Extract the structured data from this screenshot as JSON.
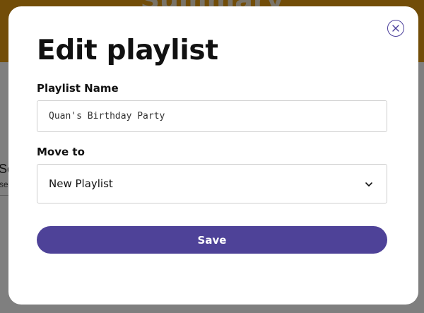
{
  "background": {
    "header_title": "Summary",
    "partial_title": "So",
    "partial_subtitle": "se"
  },
  "modal": {
    "title": "Edit playlist",
    "close_icon": "close-icon",
    "playlist_name": {
      "label": "Playlist Name",
      "value": "Quan's Birthday Party"
    },
    "move_to": {
      "label": "Move to",
      "selected": "New Playlist",
      "icon": "chevron-down-icon"
    },
    "save_label": "Save",
    "colors": {
      "accent": "#4e4298",
      "header": "#e59a11"
    }
  }
}
